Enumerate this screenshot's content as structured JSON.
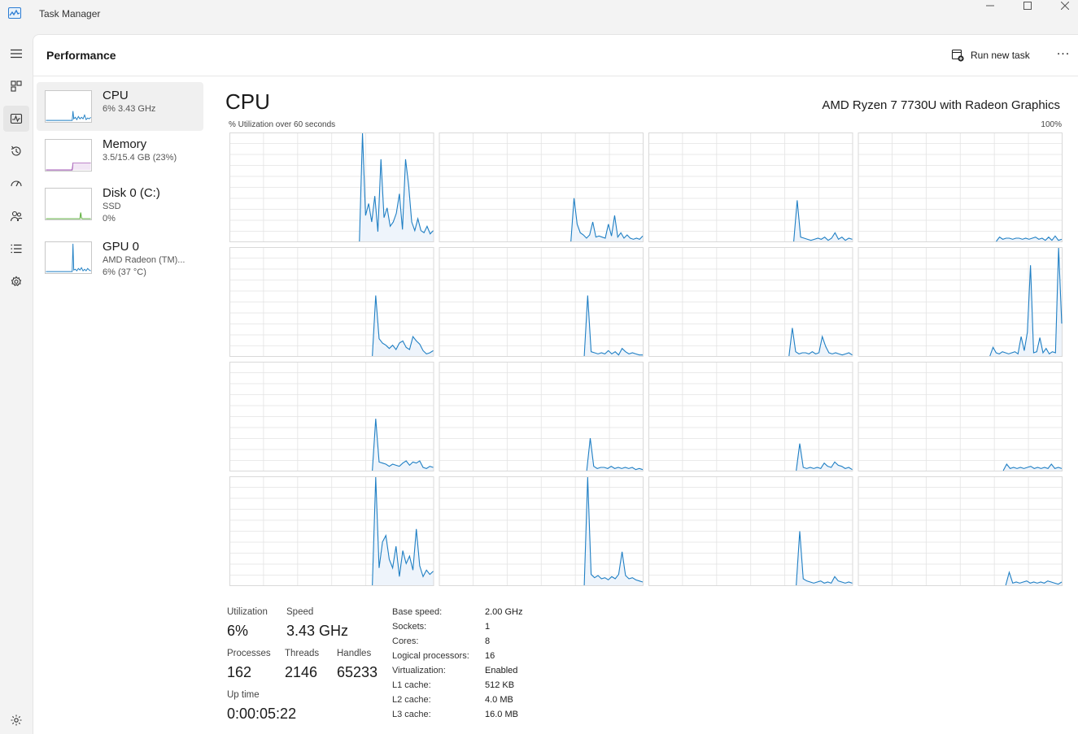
{
  "window": {
    "title": "Task Manager",
    "minimize_icon": "minimize-icon",
    "maximize_icon": "maximize-icon",
    "close_icon": "close-icon"
  },
  "nav": [
    "hamburger-icon",
    "processes-icon",
    "performance-icon",
    "app-history-icon",
    "startup-apps-icon",
    "users-icon",
    "details-icon",
    "services-icon",
    "settings-icon"
  ],
  "header": {
    "title": "Performance",
    "run_new_task": "Run new task",
    "more": "..."
  },
  "sidebar": [
    {
      "name": "CPU",
      "line1": "6% 3.43 GHz",
      "line2": "",
      "color": "#1f7fc4"
    },
    {
      "name": "Memory",
      "line1": "3.5/15.4 GB (23%)",
      "line2": "",
      "color": "#8a2ba0"
    },
    {
      "name": "Disk 0 (C:)",
      "line1": "SSD",
      "line2": "0%",
      "color": "#4ea72a"
    },
    {
      "name": "GPU 0",
      "line1": "AMD Radeon (TM)...",
      "line2": "6% (37 °C)",
      "color": "#1f7fc4"
    }
  ],
  "cpu": {
    "title": "CPU",
    "model": "AMD Ryzen 7 7730U with Radeon Graphics",
    "util_label": "% Utilization over 60 seconds",
    "util_max": "100%",
    "line_color": "#1f7fc4",
    "fill_color": "#eef4fb",
    "grid_color": "#e3e3e3",
    "logical_processor_history": [
      [
        0,
        0,
        0,
        0,
        0,
        0,
        0,
        0,
        0,
        0,
        0,
        0,
        0,
        0,
        0,
        0,
        0,
        0,
        0,
        0,
        0,
        0,
        0,
        0,
        0,
        0,
        0,
        0,
        0,
        0,
        0,
        0,
        0,
        0,
        0,
        0,
        0,
        0,
        0,
        0,
        0,
        0,
        0,
        100,
        24,
        35,
        18,
        42,
        9,
        76,
        22,
        31,
        14,
        18,
        26,
        44,
        11,
        76,
        52,
        18,
        10,
        21,
        10,
        8,
        14,
        7,
        10
      ],
      [
        0,
        0,
        0,
        0,
        0,
        0,
        0,
        0,
        0,
        0,
        0,
        0,
        0,
        0,
        0,
        0,
        0,
        0,
        0,
        0,
        0,
        0,
        0,
        0,
        0,
        0,
        0,
        0,
        0,
        0,
        0,
        0,
        0,
        0,
        0,
        0,
        0,
        0,
        0,
        0,
        0,
        0,
        0,
        40,
        16,
        8,
        6,
        3,
        6,
        18,
        4,
        5,
        4,
        3,
        16,
        5,
        24,
        4,
        8,
        3,
        6,
        3,
        2,
        3,
        2,
        5
      ],
      [
        0,
        0,
        0,
        0,
        0,
        0,
        0,
        0,
        0,
        0,
        0,
        0,
        0,
        0,
        0,
        0,
        0,
        0,
        0,
        0,
        0,
        0,
        0,
        0,
        0,
        0,
        0,
        0,
        0,
        0,
        0,
        0,
        0,
        0,
        0,
        0,
        0,
        0,
        0,
        0,
        0,
        0,
        0,
        38,
        4,
        3,
        2,
        1,
        2,
        3,
        2,
        4,
        1,
        3,
        8,
        2,
        4,
        1,
        3,
        2
      ],
      [
        0,
        0,
        0,
        0,
        0,
        0,
        0,
        0,
        0,
        0,
        0,
        0,
        0,
        0,
        0,
        0,
        0,
        0,
        0,
        0,
        0,
        0,
        0,
        0,
        0,
        0,
        0,
        0,
        0,
        0,
        0,
        0,
        0,
        0,
        0,
        0,
        0,
        0,
        0,
        0,
        0,
        0,
        0,
        4,
        2,
        3,
        3,
        2,
        3,
        3,
        2,
        3,
        2,
        3,
        4,
        2,
        3,
        1,
        4,
        1,
        5,
        1,
        2
      ],
      [
        0,
        0,
        0,
        0,
        0,
        0,
        0,
        0,
        0,
        0,
        0,
        0,
        0,
        0,
        0,
        0,
        0,
        0,
        0,
        0,
        0,
        0,
        0,
        0,
        0,
        0,
        0,
        0,
        0,
        0,
        0,
        0,
        0,
        0,
        0,
        0,
        0,
        0,
        0,
        0,
        0,
        0,
        0,
        56,
        16,
        12,
        10,
        7,
        10,
        6,
        12,
        14,
        8,
        6,
        18,
        14,
        11,
        5,
        2,
        3,
        5
      ],
      [
        0,
        0,
        0,
        0,
        0,
        0,
        0,
        0,
        0,
        0,
        0,
        0,
        0,
        0,
        0,
        0,
        0,
        0,
        0,
        0,
        0,
        0,
        0,
        0,
        0,
        0,
        0,
        0,
        0,
        0,
        0,
        0,
        0,
        0,
        0,
        0,
        0,
        0,
        0,
        0,
        0,
        0,
        0,
        56,
        4,
        3,
        2,
        3,
        2,
        5,
        2,
        4,
        1,
        7,
        4,
        2,
        3,
        2,
        1,
        1
      ],
      [
        0,
        0,
        0,
        0,
        0,
        0,
        0,
        0,
        0,
        0,
        0,
        0,
        0,
        0,
        0,
        0,
        0,
        0,
        0,
        0,
        0,
        0,
        0,
        0,
        0,
        0,
        0,
        0,
        0,
        0,
        0,
        0,
        0,
        0,
        0,
        0,
        0,
        0,
        0,
        0,
        0,
        0,
        0,
        26,
        4,
        2,
        3,
        3,
        2,
        4,
        2,
        3,
        18,
        9,
        3,
        2,
        3,
        2,
        1,
        2,
        3,
        1
      ],
      [
        0,
        0,
        0,
        0,
        0,
        0,
        0,
        0,
        0,
        0,
        0,
        0,
        0,
        0,
        0,
        0,
        0,
        0,
        0,
        0,
        0,
        0,
        0,
        0,
        0,
        0,
        0,
        0,
        0,
        0,
        0,
        0,
        0,
        0,
        0,
        0,
        0,
        0,
        0,
        0,
        0,
        0,
        0,
        8,
        3,
        2,
        4,
        3,
        2,
        3,
        4,
        2,
        18,
        5,
        22,
        84,
        3,
        4,
        17,
        3,
        7,
        2,
        4,
        3,
        100,
        30
      ],
      [
        0,
        0,
        0,
        0,
        0,
        0,
        0,
        0,
        0,
        0,
        0,
        0,
        0,
        0,
        0,
        0,
        0,
        0,
        0,
        0,
        0,
        0,
        0,
        0,
        0,
        0,
        0,
        0,
        0,
        0,
        0,
        0,
        0,
        0,
        0,
        0,
        0,
        0,
        0,
        0,
        0,
        0,
        0,
        48,
        8,
        7,
        6,
        4,
        6,
        5,
        4,
        7,
        9,
        5,
        8,
        7,
        9,
        3,
        2,
        4,
        3
      ],
      [
        0,
        0,
        0,
        0,
        0,
        0,
        0,
        0,
        0,
        0,
        0,
        0,
        0,
        0,
        0,
        0,
        0,
        0,
        0,
        0,
        0,
        0,
        0,
        0,
        0,
        0,
        0,
        0,
        0,
        0,
        0,
        0,
        0,
        0,
        0,
        0,
        0,
        0,
        0,
        0,
        0,
        0,
        0,
        30,
        4,
        2,
        3,
        3,
        2,
        4,
        2,
        3,
        2,
        3,
        2,
        3,
        1,
        2,
        1
      ],
      [
        0,
        0,
        0,
        0,
        0,
        0,
        0,
        0,
        0,
        0,
        0,
        0,
        0,
        0,
        0,
        0,
        0,
        0,
        0,
        0,
        0,
        0,
        0,
        0,
        0,
        0,
        0,
        0,
        0,
        0,
        0,
        0,
        0,
        0,
        0,
        0,
        0,
        0,
        0,
        0,
        0,
        0,
        0,
        25,
        3,
        2,
        3,
        2,
        3,
        2,
        7,
        4,
        3,
        8,
        5,
        4,
        2,
        3,
        1
      ],
      [
        0,
        0,
        0,
        0,
        0,
        0,
        0,
        0,
        0,
        0,
        0,
        0,
        0,
        0,
        0,
        0,
        0,
        0,
        0,
        0,
        0,
        0,
        0,
        0,
        0,
        0,
        0,
        0,
        0,
        0,
        0,
        0,
        0,
        0,
        0,
        0,
        0,
        0,
        0,
        0,
        0,
        0,
        0,
        6,
        2,
        3,
        2,
        3,
        2,
        3,
        4,
        2,
        3,
        2,
        3,
        2,
        6,
        2,
        3,
        2
      ],
      [
        0,
        0,
        0,
        0,
        0,
        0,
        0,
        0,
        0,
        0,
        0,
        0,
        0,
        0,
        0,
        0,
        0,
        0,
        0,
        0,
        0,
        0,
        0,
        0,
        0,
        0,
        0,
        0,
        0,
        0,
        0,
        0,
        0,
        0,
        0,
        0,
        0,
        0,
        0,
        0,
        0,
        0,
        0,
        100,
        16,
        40,
        46,
        24,
        16,
        36,
        8,
        32,
        20,
        27,
        14,
        52,
        18,
        8,
        14,
        10,
        13
      ],
      [
        0,
        0,
        0,
        0,
        0,
        0,
        0,
        0,
        0,
        0,
        0,
        0,
        0,
        0,
        0,
        0,
        0,
        0,
        0,
        0,
        0,
        0,
        0,
        0,
        0,
        0,
        0,
        0,
        0,
        0,
        0,
        0,
        0,
        0,
        0,
        0,
        0,
        0,
        0,
        0,
        0,
        0,
        0,
        100,
        10,
        7,
        9,
        6,
        7,
        5,
        8,
        6,
        10,
        31,
        9,
        6,
        7,
        5,
        4,
        3
      ],
      [
        0,
        0,
        0,
        0,
        0,
        0,
        0,
        0,
        0,
        0,
        0,
        0,
        0,
        0,
        0,
        0,
        0,
        0,
        0,
        0,
        0,
        0,
        0,
        0,
        0,
        0,
        0,
        0,
        0,
        0,
        0,
        0,
        0,
        0,
        0,
        0,
        0,
        0,
        0,
        0,
        0,
        0,
        0,
        50,
        6,
        4,
        3,
        2,
        3,
        4,
        2,
        3,
        2,
        8,
        4,
        3,
        2,
        3,
        2
      ],
      [
        0,
        0,
        0,
        0,
        0,
        0,
        0,
        0,
        0,
        0,
        0,
        0,
        0,
        0,
        0,
        0,
        0,
        0,
        0,
        0,
        0,
        0,
        0,
        0,
        0,
        0,
        0,
        0,
        0,
        0,
        0,
        0,
        0,
        0,
        0,
        0,
        0,
        0,
        0,
        0,
        0,
        0,
        0,
        12,
        2,
        3,
        2,
        3,
        4,
        2,
        3,
        2,
        3,
        2,
        4,
        3,
        2,
        1,
        3
      ]
    ]
  },
  "stats": {
    "utilization_label": "Utilization",
    "utilization": "6%",
    "speed_label": "Speed",
    "speed": "3.43 GHz",
    "processes_label": "Processes",
    "processes": "162",
    "threads_label": "Threads",
    "threads": "2146",
    "handles_label": "Handles",
    "handles": "65233",
    "uptime_label": "Up time",
    "uptime": "0:00:05:22"
  },
  "specs": [
    {
      "label": "Base speed:",
      "value": "2.00 GHz"
    },
    {
      "label": "Sockets:",
      "value": "1"
    },
    {
      "label": "Cores:",
      "value": "8"
    },
    {
      "label": "Logical processors:",
      "value": "16"
    },
    {
      "label": "Virtualization:",
      "value": "Enabled"
    },
    {
      "label": "L1 cache:",
      "value": "512 KB"
    },
    {
      "label": "L2 cache:",
      "value": "4.0 MB"
    },
    {
      "label": "L3 cache:",
      "value": "16.0 MB"
    }
  ]
}
